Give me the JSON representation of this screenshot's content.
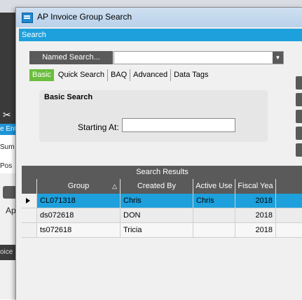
{
  "background_app": {
    "tab_label": "e Ent",
    "item_1": "Sum",
    "item_2": "Pos",
    "ap_label": "Ap",
    "bottom_label": "oice"
  },
  "window": {
    "title": "AP Invoice Group Search"
  },
  "search_bar": {
    "label": "Search"
  },
  "named_search": {
    "button_label": "Named Search...",
    "value": ""
  },
  "tabs": [
    {
      "label": "Basic",
      "active": true
    },
    {
      "label": "Quick Search",
      "active": false
    },
    {
      "label": "BAQ",
      "active": false
    },
    {
      "label": "Advanced",
      "active": false
    },
    {
      "label": "Data Tags",
      "active": false
    }
  ],
  "basic_search": {
    "title": "Basic Search",
    "starting_at_label": "Starting At:",
    "starting_at_value": ""
  },
  "results": {
    "header": "Search Results",
    "columns": [
      "Group",
      "Created By",
      "Active Use",
      "Fiscal Yea"
    ],
    "rows": [
      {
        "group": "CL071318",
        "created_by": "Chris",
        "active_user": "Chris",
        "fiscal_year": "2018"
      },
      {
        "group": "ds072618",
        "created_by": "DON",
        "active_user": "",
        "fiscal_year": "2018"
      },
      {
        "group": "ts072618",
        "created_by": "Tricia",
        "active_user": "",
        "fiscal_year": "2018"
      }
    ]
  },
  "colors": {
    "accent_blue": "#1ea0dc",
    "active_tab_green": "#6abe3c",
    "dark_gray": "#5a5a5a"
  }
}
